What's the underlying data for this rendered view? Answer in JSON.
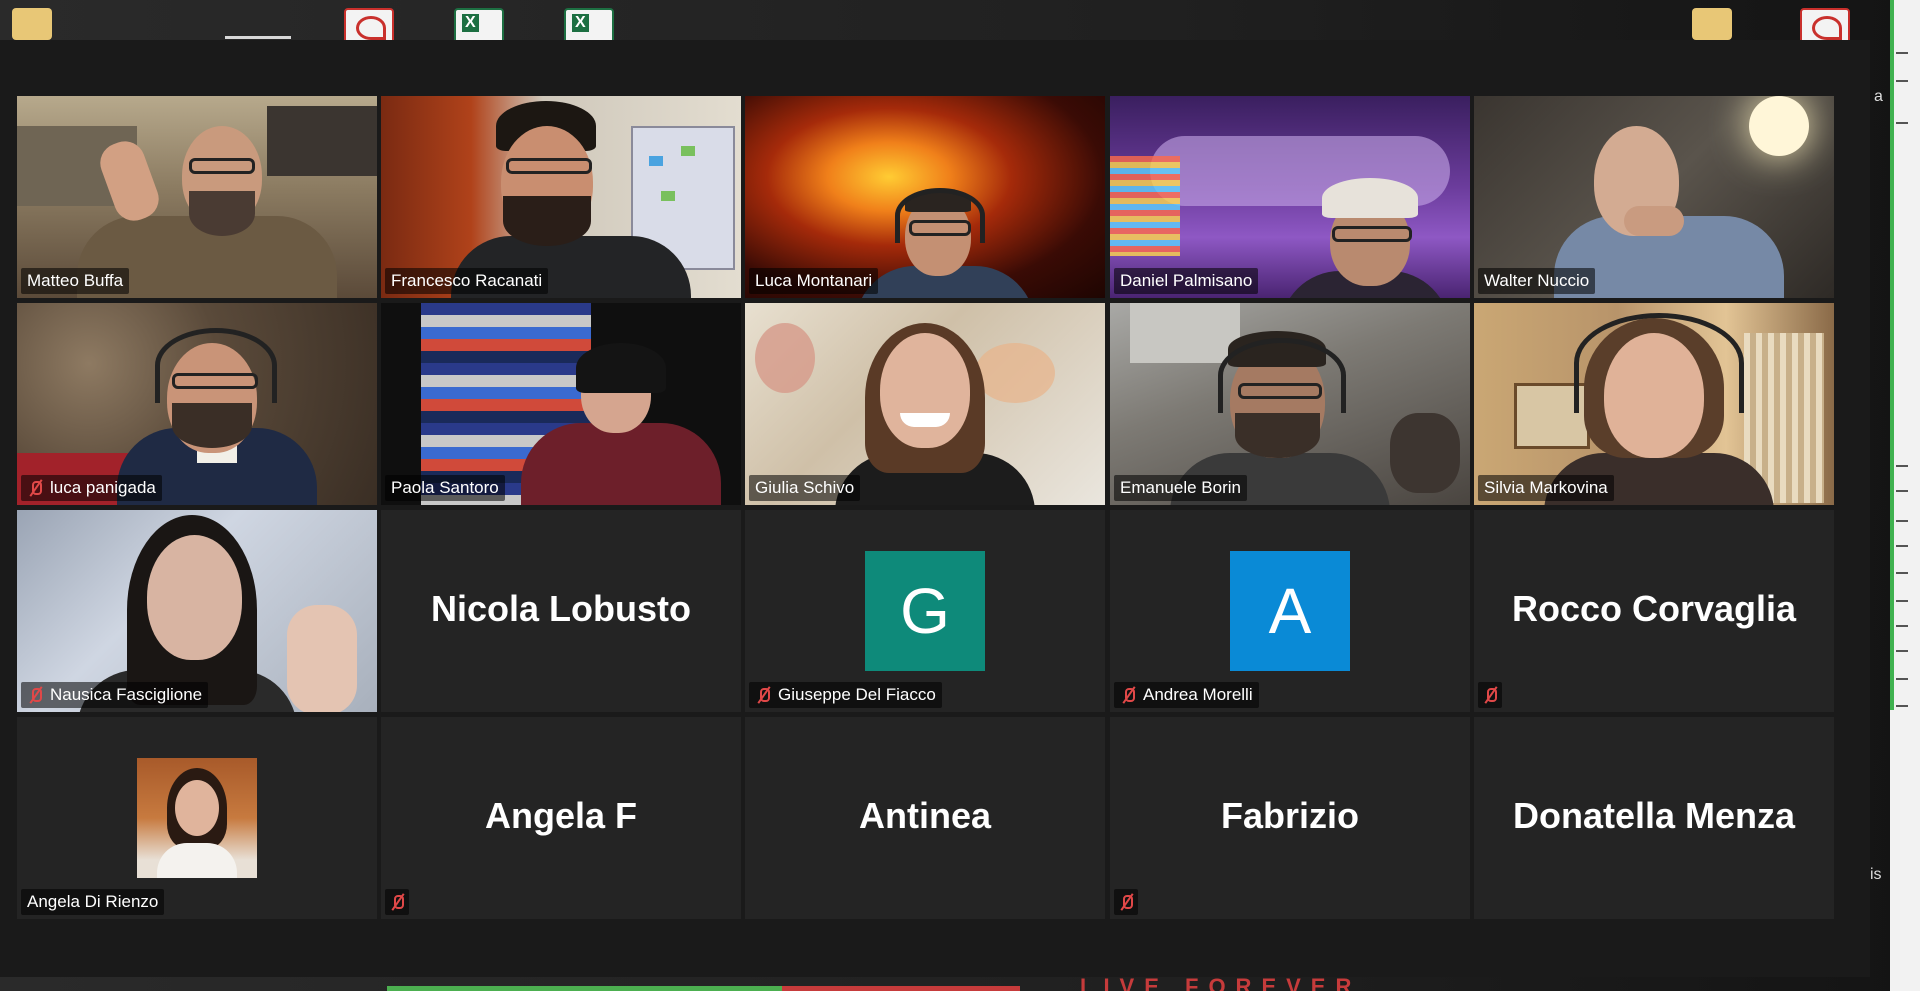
{
  "app": "Zoom",
  "desktop": {
    "right_edge_text": [
      "a",
      "is"
    ]
  },
  "participants": [
    {
      "name": "Matteo Buffa",
      "muted": false,
      "mode": "video",
      "active": false
    },
    {
      "name": "Francesco Racanati",
      "muted": false,
      "mode": "video",
      "active": false
    },
    {
      "name": "Luca Montanari",
      "muted": false,
      "mode": "video",
      "active": false
    },
    {
      "name": "Daniel Palmisano",
      "muted": false,
      "mode": "video",
      "active": false
    },
    {
      "name": "Walter Nuccio",
      "muted": false,
      "mode": "video",
      "active": false
    },
    {
      "name": "luca panigada",
      "muted": true,
      "mode": "video",
      "active": false
    },
    {
      "name": "Paola Santoro",
      "muted": false,
      "mode": "video",
      "active": false
    },
    {
      "name": "Giulia Schivo",
      "muted": false,
      "mode": "video",
      "active": false
    },
    {
      "name": "Emanuele Borin",
      "muted": false,
      "mode": "video",
      "active": false
    },
    {
      "name": "Silvia Markovina",
      "muted": false,
      "mode": "video",
      "active": true
    },
    {
      "name": "Nausica Fasciglione",
      "muted": true,
      "mode": "video",
      "active": false
    },
    {
      "name": "Nicola Lobusto",
      "muted": false,
      "mode": "name",
      "active": false
    },
    {
      "name": "Giuseppe Del Fiacco",
      "muted": true,
      "mode": "avatar",
      "initial": "G",
      "avatar_color": "#0e8a7a",
      "active": false
    },
    {
      "name": "Andrea Morelli",
      "muted": true,
      "mode": "avatar",
      "initial": "A",
      "avatar_color": "#0a8ad6",
      "active": false
    },
    {
      "name": "Rocco Corvaglia",
      "muted": true,
      "mode": "name",
      "active": false
    },
    {
      "name": "Angela Di Rienzo",
      "muted": false,
      "mode": "photo",
      "active": false
    },
    {
      "name": "Angela F",
      "muted": true,
      "mode": "name",
      "active": false
    },
    {
      "name": "Antinea",
      "muted": false,
      "mode": "name",
      "active": false
    },
    {
      "name": "Fabrizio",
      "muted": true,
      "mode": "name",
      "active": false
    },
    {
      "name": "Donatella Menza",
      "muted": false,
      "mode": "name",
      "active": false
    }
  ],
  "colors": {
    "active_speaker_border": "#d6e87a",
    "mute_icon": "#e04848",
    "tile_bg": "#242424",
    "window_bg": "#1a1a1a"
  }
}
